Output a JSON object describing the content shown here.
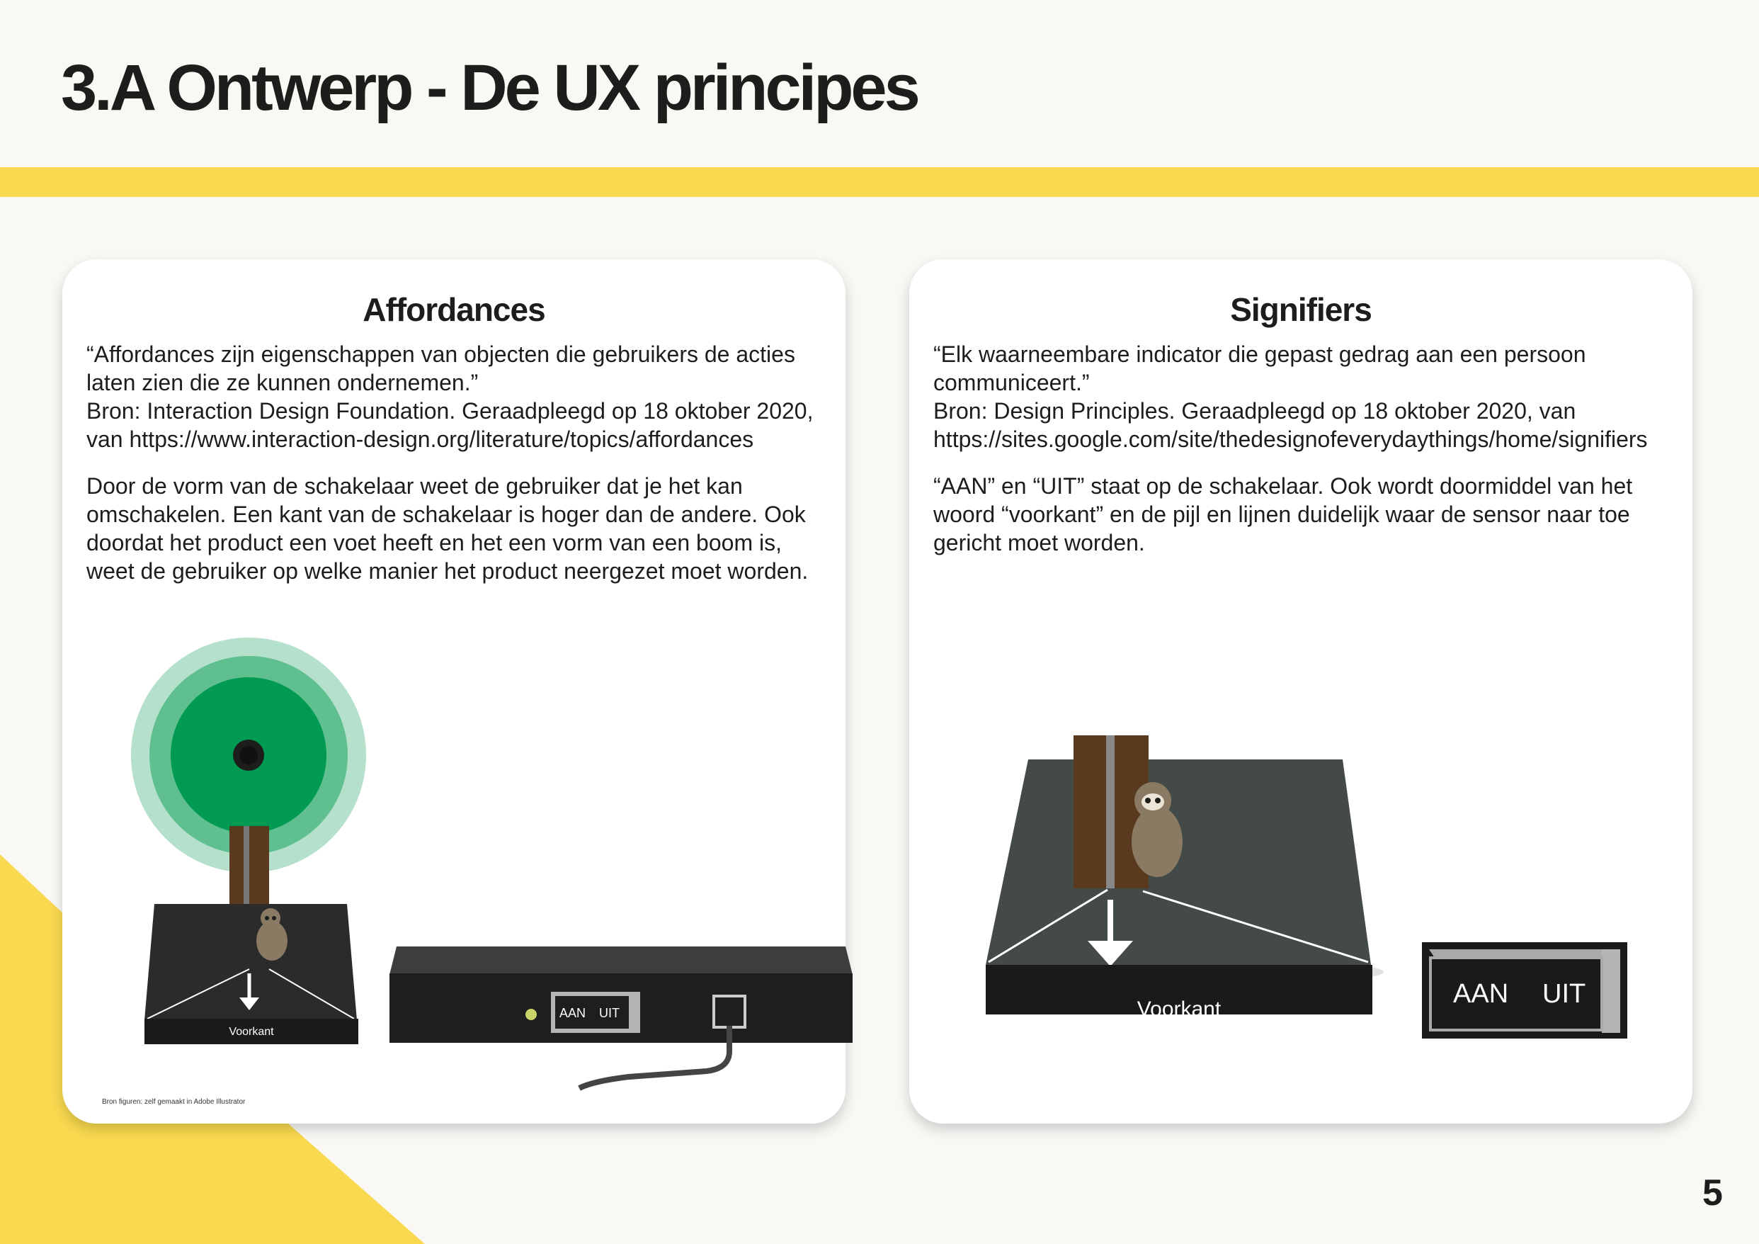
{
  "page": {
    "title": "3.A Ontwerp - De UX principes",
    "page_number": "5",
    "colors": {
      "accent_yellow": "#f9d94f",
      "background": "#f9f8f5",
      "tree_green": "#009a53"
    }
  },
  "affordances": {
    "title": "Affordances",
    "quote": "“Affordances zijn eigenschappen van objecten die gebruikers de acties laten zien die ze kunnen ondernemen.”",
    "source": "Bron: Interaction Design Foundation. Geraadpleegd op 18 oktober 2020, van https://www.interaction-design.org/literature/topics/affordances",
    "body": "Door de vorm van de schakelaar weet de gebruiker dat je het kan omschakelen. Een kant van de schakelaar is hoger dan de andere. Ook doordat het product een voet heeft en het een vorm van een boom is, weet de gebruiker op welke manier het product neergezet moet worden.",
    "figure_front_label": "Voorkant",
    "switch_on": "AAN",
    "switch_off": "UIT",
    "credit": "Bron figuren: zelf gemaakt in Adobe Illustrator"
  },
  "signifiers": {
    "title": "Signifiers",
    "quote": "“Elk waarneembare indicator die gepast gedrag aan een persoon communiceert.”",
    "source": "Bron: Design Principles. Geraadpleegd op 18 oktober 2020, van https://sites.google.com/site/thedesignofeverydaythings/home/signifiers",
    "body": "“AAN” en “UIT” staat op de schakelaar. Ook wordt doormiddel van het woord “voorkant” en de pijl en lijnen duidelijk waar de sensor naar toe gericht moet worden.",
    "figure_front_label": "Voorkant",
    "switch_on": "AAN",
    "switch_off": "UIT"
  }
}
